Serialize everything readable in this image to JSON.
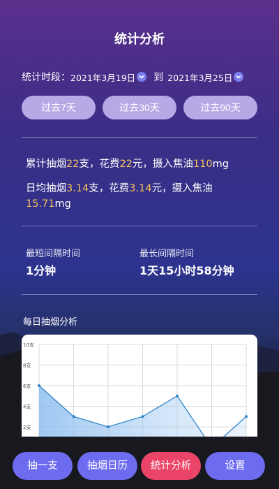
{
  "header": {
    "title": "统计分析"
  },
  "range": {
    "label": "统计时段：",
    "start": "2021年3月19日",
    "to": "到",
    "end": "2021年3月25日"
  },
  "periods": [
    "过去7天",
    "过去30天",
    "过去90天"
  ],
  "summary": {
    "line1": [
      "累计抽烟",
      "22",
      "支，花费",
      "22",
      "元，摄入焦油",
      "110",
      "mg"
    ],
    "line2": [
      "日均抽烟",
      "3.14",
      "支，花费",
      "3.14",
      "元，摄入焦油",
      "15.71",
      "mg"
    ]
  },
  "intervals": {
    "shortest_label": "最短间隔时间",
    "shortest_value": "1分钟",
    "longest_label": "最长间隔时间",
    "longest_value": "1天15小时58分钟"
  },
  "chart_title": "每日抽烟分析",
  "chart_data": {
    "type": "area",
    "y_ticks": [
      "10支",
      "8支",
      "6支",
      "4支",
      "2支"
    ],
    "ylim": [
      0,
      10
    ],
    "values": [
      6,
      3,
      2,
      3,
      5,
      0,
      3
    ],
    "grid": true
  },
  "tabs": [
    {
      "label": "抽一支",
      "color": "#6d6bf0"
    },
    {
      "label": "抽烟日历",
      "color": "#6d6bf0"
    },
    {
      "label": "统计分析",
      "color": "#ea4468"
    },
    {
      "label": "设置",
      "color": "#6d6bf0"
    }
  ],
  "colors": {
    "accent_highlight": "#f5c15b",
    "line": "#2f85c8"
  }
}
